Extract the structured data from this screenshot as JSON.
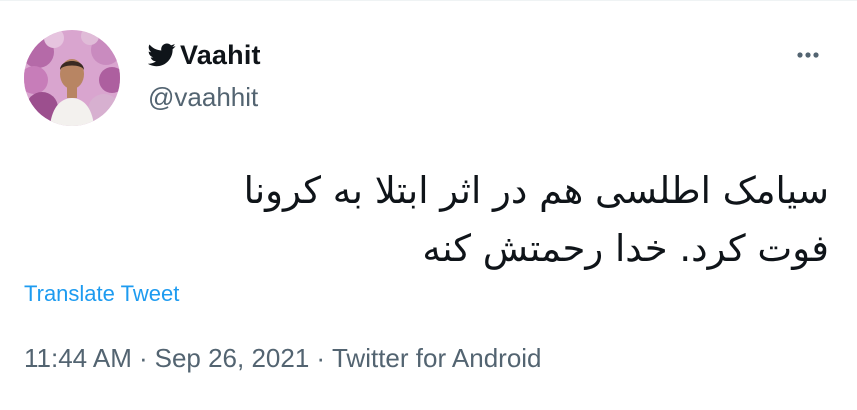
{
  "tweet": {
    "author": {
      "display_name": "Vaahit",
      "handle": "@vaahhit",
      "badge_icon": "twitter-bird-icon",
      "avatar_icon": "profile-photo"
    },
    "more_icon": "more-horizontal-icon",
    "text_lines": [
      "سیامک اطلسی هم در اثر ابتلا به کرونا",
      "فوت کرد. خدا رحمتش کنه"
    ],
    "translate_label": "Translate Tweet",
    "meta": {
      "time": "11:44 AM",
      "separator": "·",
      "date": "Sep 26, 2021",
      "source": "Twitter for Android"
    }
  },
  "colors": {
    "text_primary": "#0f1419",
    "text_secondary": "#536471",
    "link": "#1d9bf0",
    "divider": "#eff3f4"
  }
}
